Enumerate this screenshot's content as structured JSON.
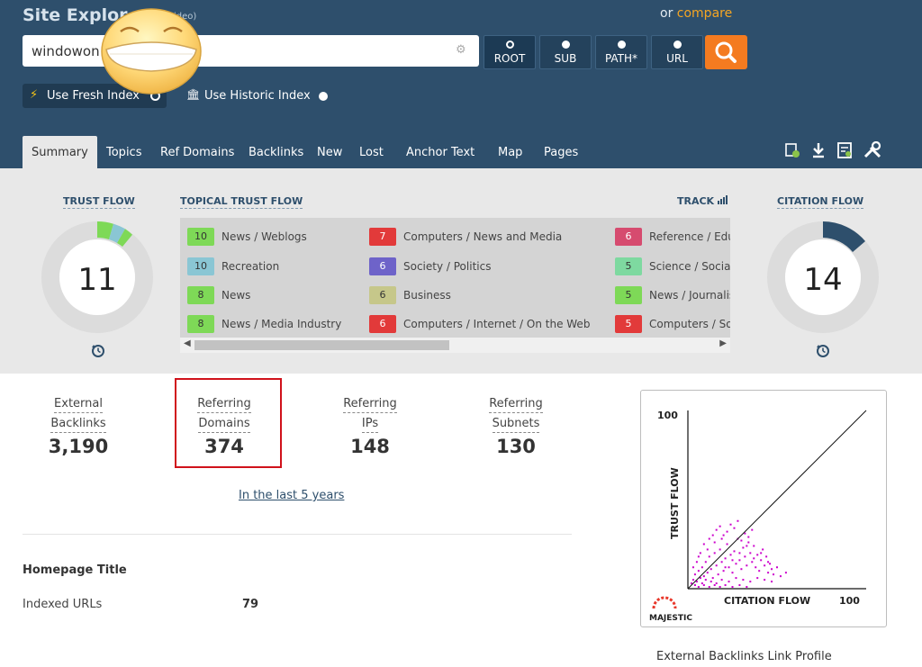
{
  "header": {
    "title": "Site Explor",
    "subtitle": "y video)",
    "compare_prefix": "or",
    "compare_link": "compare",
    "search_value": "windowon",
    "scopes": [
      {
        "label": "ROOT",
        "active": true
      },
      {
        "label": "SUB",
        "active": false
      },
      {
        "label": "PATH*",
        "active": false
      },
      {
        "label": "URL",
        "active": false
      }
    ],
    "fresh_index_label": "Use Fresh Index",
    "historic_index_label": "Use Historic Index"
  },
  "tabs": [
    "Summary",
    "Topics",
    "Ref Domains",
    "Backlinks",
    "New",
    "Lost",
    "Anchor Text",
    "Map",
    "Pages"
  ],
  "tool_icons": [
    "add-report-icon",
    "download-icon",
    "report-icon",
    "tools-icon"
  ],
  "metrics": {
    "trust_flow_label": "TRUST FLOW",
    "trust_flow_value": "11",
    "topical_label": "TOPICAL TRUST FLOW",
    "track_label": "TRACK",
    "citation_flow_label": "CITATION FLOW",
    "citation_flow_value": "14"
  },
  "topical_trust_flow": [
    {
      "value": "10",
      "name": "News / Weblogs",
      "color": "#7ed957"
    },
    {
      "value": "10",
      "name": "Recreation",
      "color": "#8ac6d4"
    },
    {
      "value": "8",
      "name": "News",
      "color": "#7ed957"
    },
    {
      "value": "8",
      "name": "News / Media Industry",
      "color": "#7ed957"
    },
    {
      "value": "7",
      "name": "Computers / News and Media",
      "color": "#e23a3a"
    },
    {
      "value": "6",
      "name": "Society / Politics",
      "color": "#6e63c9"
    },
    {
      "value": "6",
      "name": "Business",
      "color": "#c6c78a"
    },
    {
      "value": "6",
      "name": "Computers / Internet / On the Web",
      "color": "#e23a3a"
    },
    {
      "value": "6",
      "name": "Reference / Edu",
      "color": "#d64b6f"
    },
    {
      "value": "5",
      "name": "Science / Social",
      "color": "#7ed9a0"
    },
    {
      "value": "5",
      "name": "News / Journalis",
      "color": "#7ed957"
    },
    {
      "value": "5",
      "name": "Computers / So",
      "color": "#e23a3a"
    }
  ],
  "stats": [
    {
      "line1": "External",
      "line2": "Backlinks",
      "value": "3,190"
    },
    {
      "line1": "Referring",
      "line2": "Domains",
      "value": "374"
    },
    {
      "line1": "Referring",
      "line2": "IPs",
      "value": "148"
    },
    {
      "line1": "Referring",
      "line2": "Subnets",
      "value": "130"
    }
  ],
  "timeframe_link": "In the last 5 years",
  "homepage_title_label": "Homepage Title",
  "indexed_urls_label": "Indexed URLs",
  "indexed_urls_value": "79",
  "link_profile": {
    "caption": "External Backlinks Link Profile",
    "logo_text": "MAJESTIC"
  },
  "chart_data": {
    "type": "scatter",
    "xlabel": "CITATION FLOW",
    "ylabel": "TRUST FLOW",
    "xlim": [
      0,
      100
    ],
    "ylim": [
      0,
      100
    ],
    "x_max_label": "100",
    "y_max_label": "100",
    "reference_line": "diagonal",
    "point_color": "#cc00cc",
    "points": [
      [
        2,
        3
      ],
      [
        3,
        5
      ],
      [
        4,
        8
      ],
      [
        5,
        4
      ],
      [
        6,
        10
      ],
      [
        7,
        6
      ],
      [
        8,
        12
      ],
      [
        9,
        7
      ],
      [
        10,
        15
      ],
      [
        11,
        9
      ],
      [
        12,
        18
      ],
      [
        13,
        11
      ],
      [
        14,
        6
      ],
      [
        15,
        20
      ],
      [
        16,
        13
      ],
      [
        17,
        8
      ],
      [
        18,
        22
      ],
      [
        19,
        15
      ],
      [
        20,
        10
      ],
      [
        21,
        17
      ],
      [
        22,
        25
      ],
      [
        23,
        12
      ],
      [
        24,
        19
      ],
      [
        25,
        9
      ],
      [
        26,
        21
      ],
      [
        27,
        14
      ],
      [
        28,
        28
      ],
      [
        29,
        16
      ],
      [
        30,
        11
      ],
      [
        31,
        23
      ],
      [
        32,
        18
      ],
      [
        33,
        13
      ],
      [
        34,
        26
      ],
      [
        35,
        20
      ],
      [
        36,
        15
      ],
      [
        37,
        24
      ],
      [
        38,
        12
      ],
      [
        39,
        19
      ],
      [
        40,
        10
      ],
      [
        41,
        16
      ],
      [
        42,
        22
      ],
      [
        43,
        13
      ],
      [
        44,
        18
      ],
      [
        45,
        9
      ],
      [
        46,
        14
      ],
      [
        47,
        11
      ],
      [
        48,
        8
      ],
      [
        50,
        12
      ],
      [
        52,
        7
      ],
      [
        55,
        9
      ],
      [
        5,
        15
      ],
      [
        7,
        20
      ],
      [
        9,
        25
      ],
      [
        12,
        28
      ],
      [
        14,
        30
      ],
      [
        16,
        33
      ],
      [
        18,
        35
      ],
      [
        20,
        30
      ],
      [
        22,
        32
      ],
      [
        24,
        36
      ],
      [
        26,
        34
      ],
      [
        28,
        38
      ],
      [
        30,
        27
      ],
      [
        32,
        31
      ],
      [
        34,
        29
      ],
      [
        36,
        33
      ],
      [
        3,
        12
      ],
      [
        6,
        18
      ],
      [
        8,
        3
      ],
      [
        10,
        5
      ],
      [
        13,
        4
      ],
      [
        16,
        3
      ],
      [
        19,
        5
      ],
      [
        23,
        4
      ],
      [
        27,
        6
      ],
      [
        31,
        5
      ],
      [
        35,
        4
      ],
      [
        39,
        6
      ],
      [
        43,
        5
      ],
      [
        47,
        4
      ],
      [
        4,
        2
      ],
      [
        6,
        1
      ],
      [
        9,
        2
      ],
      [
        12,
        1
      ],
      [
        15,
        2
      ],
      [
        18,
        1
      ],
      [
        21,
        2
      ],
      [
        25,
        1
      ],
      [
        29,
        2
      ],
      [
        33,
        1
      ],
      [
        11,
        22
      ],
      [
        15,
        26
      ],
      [
        19,
        28
      ],
      [
        21,
        12
      ],
      [
        25,
        16
      ],
      [
        29,
        20
      ],
      [
        33,
        24
      ],
      [
        37,
        17
      ],
      [
        41,
        20
      ],
      [
        45,
        15
      ]
    ]
  }
}
